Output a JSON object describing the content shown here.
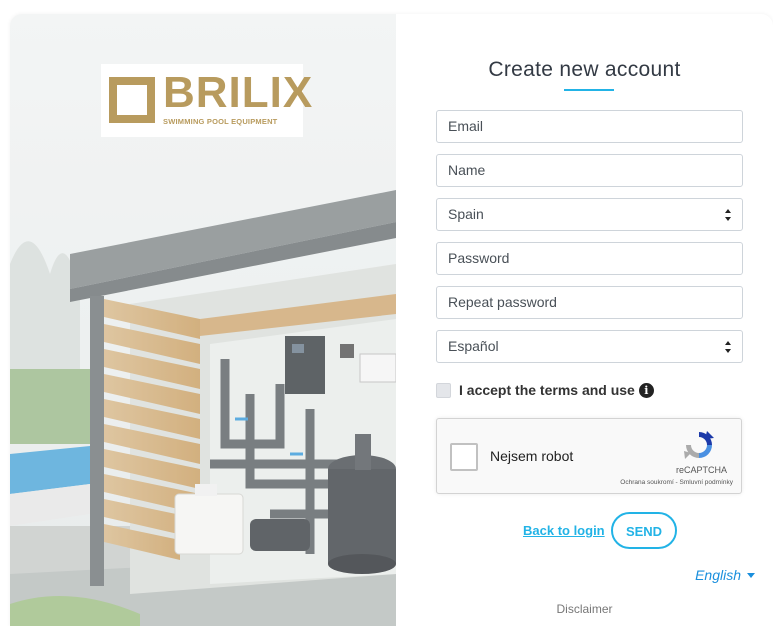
{
  "brand": {
    "name": "BRILIX",
    "tagline": "SWIMMING POOL EQUIPMENT",
    "color": "#b89b5e"
  },
  "form": {
    "title": "Create new account",
    "accent_color": "#22b3e6",
    "fields": {
      "email_placeholder": "Email",
      "name_placeholder": "Name",
      "country_selected": "Spain",
      "password_placeholder": "Password",
      "repeat_password_placeholder": "Repeat password",
      "language_selected": "Español"
    },
    "terms_label": "I accept the terms and use",
    "terms_info_icon": "info-icon",
    "captcha": {
      "label": "Nejsem robot",
      "brand": "reCAPTCHA",
      "links": "Ochrana soukromí - Smluvní podmínky"
    },
    "back_link": "Back to login",
    "send_label": "SEND"
  },
  "footer": {
    "language": "English",
    "disclaimer": "Disclaimer"
  }
}
